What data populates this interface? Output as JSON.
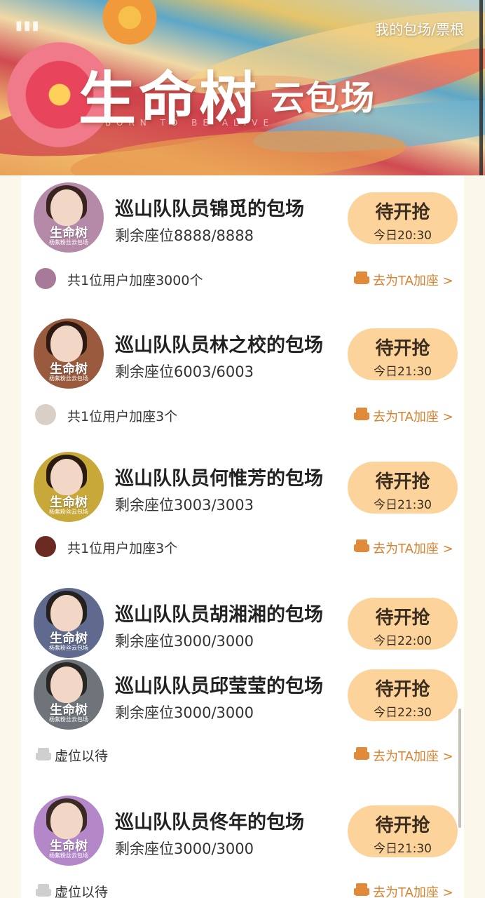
{
  "banner": {
    "top_link": "我的包场/票根",
    "title_main": "生命树",
    "title_sub": "云包场",
    "tagline": "BORN TO BE ALIVE"
  },
  "colors": {
    "page_bg": "#fbf7ea",
    "button_bg": "#fcd39a",
    "link_orange": "#d9822f",
    "text_dark": "#222222"
  },
  "avatar_logo_text": "生命树",
  "avatar_caption": "杨紫粉丝云包场",
  "rows": [
    {
      "title": "巡山队队员锦觅的包场",
      "seats": "剩余座位8888/8888",
      "button": "待开抢",
      "time": "今日20:30"
    },
    {
      "title": "巡山队队员林之校的包场",
      "seats": "剩余座位6003/6003",
      "button": "待开抢",
      "time": "今日21:30"
    },
    {
      "title": "巡山队队员何惟芳的包场",
      "seats": "剩余座位3003/3003",
      "button": "待开抢",
      "time": "今日21:30"
    },
    {
      "title": "巡山队队员胡湘湘的包场",
      "seats": "剩余座位3000/3000",
      "button": "待开抢",
      "time": "今日22:00"
    },
    {
      "title": "巡山队队员邱莹莹的包场",
      "seats": "剩余座位3000/3000",
      "button": "待开抢",
      "time": "今日22:30"
    },
    {
      "title": "巡山队队员佟年的包场",
      "seats": "剩余座位3000/3000",
      "button": "待开抢",
      "time": "今日21:30"
    }
  ],
  "footers": [
    {
      "text": "共1位用户加座3000个",
      "link": "去为TA加座 >",
      "icon": "user-avatar"
    },
    {
      "text": "共1位用户加座3个",
      "link": "去为TA加座 >",
      "icon": "user-avatar"
    },
    {
      "text": "共1位用户加座3个",
      "link": "去为TA加座 >",
      "icon": "user-avatar"
    },
    {
      "text": "虚位以待",
      "link": "去为TA加座 >",
      "icon": "empty-seat-icon"
    },
    {
      "text": "虚位以待",
      "link": "去为TA加座 >",
      "icon": "empty-seat-icon"
    }
  ]
}
